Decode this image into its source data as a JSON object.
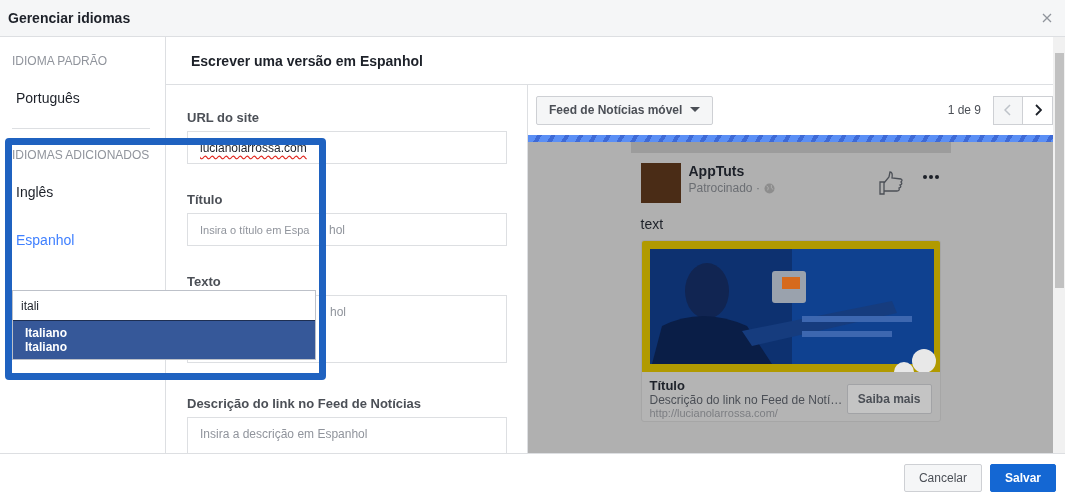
{
  "window": {
    "title": "Gerenciar idiomas"
  },
  "sidebar": {
    "default_heading": "IDIOMA PADRÃO",
    "default_language": "Português",
    "added_heading": "IDIOMAS ADICIONADOS",
    "languages": [
      {
        "label": "Inglês",
        "selected": false
      },
      {
        "label": "Espanhol",
        "selected": true
      }
    ],
    "language_search": {
      "value": "itali",
      "suggestions": [
        {
          "name": "Italiano",
          "native_name": "Italiano",
          "selected": true
        }
      ]
    }
  },
  "editor": {
    "heading": "Escrever uma versão em Espanhol",
    "fields": [
      {
        "label": "URL do site",
        "value": "lucianolarrossa.com",
        "kind": "input"
      },
      {
        "label": "Título",
        "placeholder": "Insira o título em Espa",
        "placeholder_after_frame": "hol",
        "kind": "input"
      },
      {
        "label": "Texto",
        "placeholder": "hol",
        "kind": "textarea"
      },
      {
        "label": "Descrição do link no Feed de Notícias",
        "placeholder": "Insira a descrição em Espanhol",
        "kind": "textarea"
      }
    ]
  },
  "preview": {
    "placement": "Feed de Notícias móvel",
    "pager": "1 de 9",
    "post": {
      "page_name": "AppTuts",
      "sponsored": "Patrocinado ·",
      "text": "text",
      "link": {
        "title": "Título",
        "description": "Descrição do link no Feed de Notí…",
        "url": "http://lucianolarrossa.com/",
        "cta": "Saiba mais"
      }
    }
  },
  "buttons": [
    {
      "label": "Cancelar",
      "kind": "secondary"
    },
    {
      "label": "Salvar",
      "kind": "primary"
    }
  ]
}
